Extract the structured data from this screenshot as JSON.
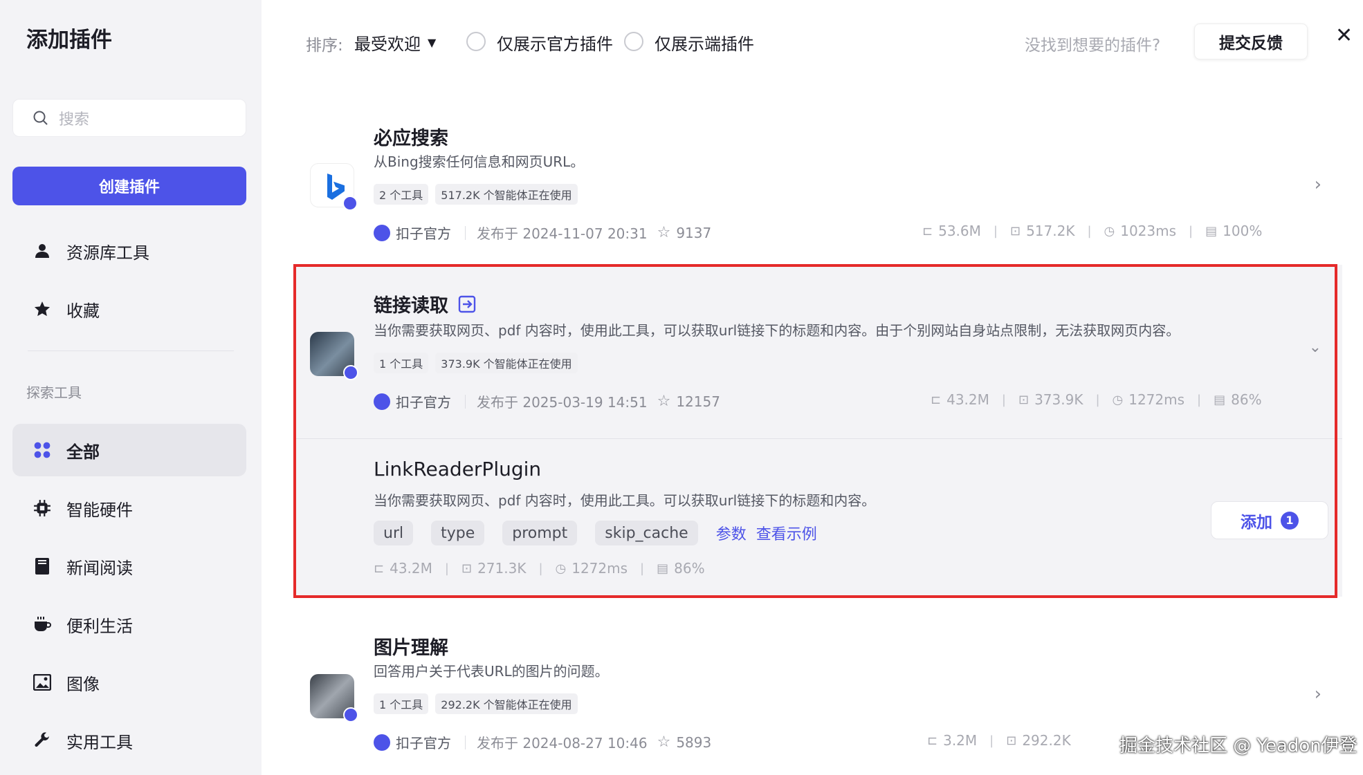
{
  "sidebar": {
    "title": "添加插件",
    "search_placeholder": "搜索",
    "create_button": "创建插件",
    "items": [
      {
        "label": "资源库工具",
        "icon": "user-icon"
      },
      {
        "label": "收藏",
        "icon": "star-icon"
      }
    ],
    "section_label": "探索工具",
    "categories": [
      {
        "label": "全部",
        "icon": "grid-icon",
        "active": true
      },
      {
        "label": "智能硬件",
        "icon": "chip-icon"
      },
      {
        "label": "新闻阅读",
        "icon": "book-icon"
      },
      {
        "label": "便利生活",
        "icon": "cup-icon"
      },
      {
        "label": "图像",
        "icon": "image-icon"
      },
      {
        "label": "实用工具",
        "icon": "wrench-icon"
      }
    ]
  },
  "topbar": {
    "sort_label": "排序:",
    "sort_value": "最受欢迎",
    "filter_official": "仅展示官方插件",
    "filter_device": "仅展示端插件",
    "hint": "没找到想要的插件?",
    "feedback_button": "提交反馈"
  },
  "plugins": [
    {
      "name": "必应搜索",
      "description": "从Bing搜索任何信息和网页URL。",
      "tags": [
        "2 个工具",
        "517.2K 个智能体正在使用"
      ],
      "author": "扣子官方",
      "published": "发布于 2024-11-07 20:31",
      "stars": "9137",
      "stats": [
        "53.6M",
        "517.2K",
        "1023ms",
        "100%"
      ]
    },
    {
      "name": "链接读取",
      "description": "当你需要获取网页、pdf 内容时，使用此工具，可以获取url链接下的标题和内容。由于个别网站自身站点限制，无法获取网页内容。",
      "tags": [
        "1 个工具",
        "373.9K 个智能体正在使用"
      ],
      "author": "扣子官方",
      "published": "发布于 2025-03-19 14:51",
      "stars": "12157",
      "stats": [
        "43.2M",
        "373.9K",
        "1272ms",
        "86%"
      ]
    },
    {
      "name": "图片理解",
      "description": "回答用户关于代表URL的图片的问题。",
      "tags": [
        "1 个工具",
        "292.2K 个智能体正在使用"
      ],
      "author": "扣子官方",
      "published": "发布于 2024-08-27 10:46",
      "stars": "5893",
      "stats": [
        "3.2M",
        "292.2K"
      ]
    }
  ],
  "tool": {
    "name": "LinkReaderPlugin",
    "description": "当你需要获取网页、pdf 内容时，使用此工具。可以获取url链接下的标题和内容。",
    "params": [
      "url",
      "type",
      "prompt",
      "skip_cache"
    ],
    "params_link": "参数",
    "example_link": "查看示例",
    "stats": [
      "43.2M",
      "271.3K",
      "1272ms",
      "86%"
    ],
    "add_button": "添加",
    "add_count": "1"
  },
  "watermark": "掘金技术社区 @ Yeadon伊登",
  "colors": {
    "accent": "#4d53e8",
    "highlight": "#e52a2a"
  }
}
